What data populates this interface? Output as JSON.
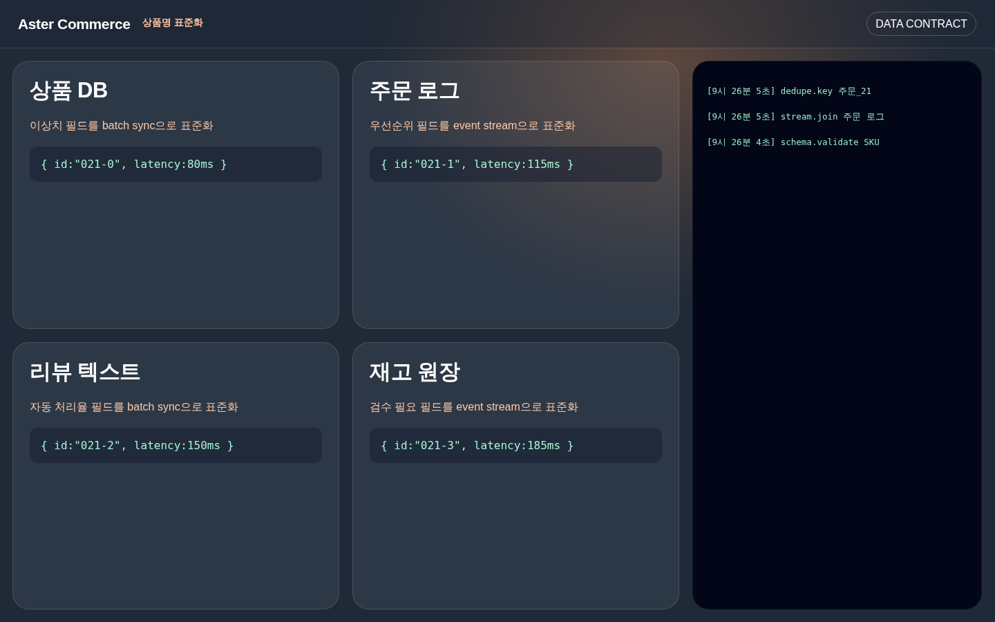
{
  "header": {
    "brand": "Aster Commerce",
    "subtitle": "상품명 표준화",
    "button": "DATA CONTRACT"
  },
  "cards": [
    {
      "title": "상품 DB",
      "description": "이상치 필드를 batch sync으로 표준화",
      "code": "{ id:\"021-0\", latency:80ms }"
    },
    {
      "title": "주문 로그",
      "description": "우선순위 필드를 event stream으로 표준화",
      "code": "{ id:\"021-1\", latency:115ms }"
    },
    {
      "title": "리뷰 텍스트",
      "description": "자동 처리율 필드를 batch sync으로 표준화",
      "code": "{ id:\"021-2\", latency:150ms }"
    },
    {
      "title": "재고 원장",
      "description": "검수 필요 필드를 event stream으로 표준화",
      "code": "{ id:\"021-3\", latency:185ms }"
    }
  ],
  "log": {
    "lines": [
      "[9시 26분 5초] dedupe.key 주문_21",
      "[9시 26분 5초] stream.join 주문 로그",
      "[9시 26분 4초] schema.validate SKU"
    ]
  }
}
